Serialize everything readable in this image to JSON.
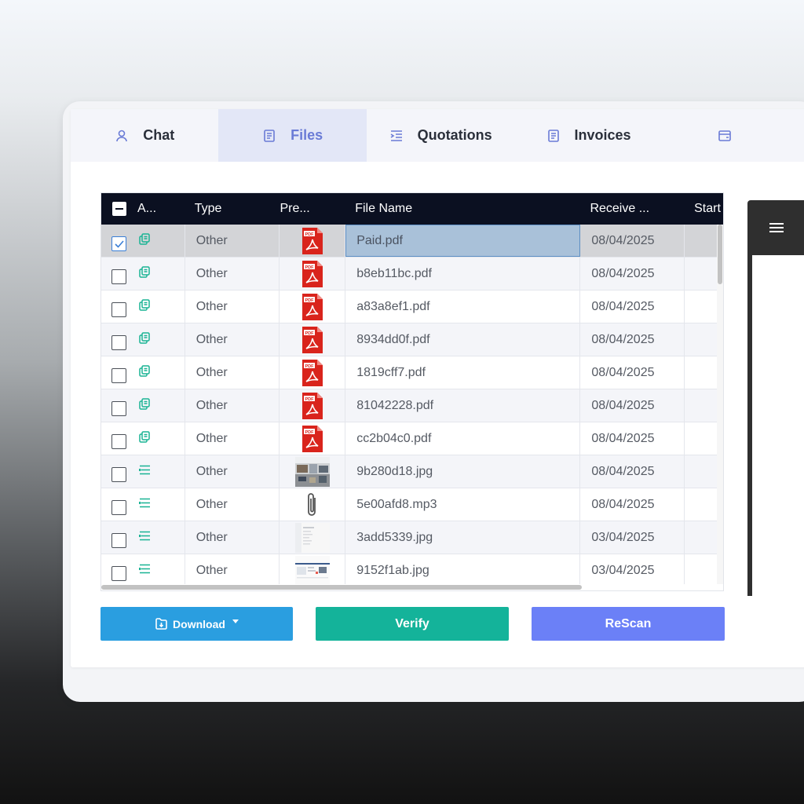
{
  "tabs": [
    {
      "label": "Chat",
      "icon": "user-icon",
      "active": false
    },
    {
      "label": "Files",
      "icon": "document-icon",
      "active": true
    },
    {
      "label": "Quotations",
      "icon": "list-indent-icon",
      "active": false
    },
    {
      "label": "Invoices",
      "icon": "document-icon",
      "active": false
    },
    {
      "label": "",
      "icon": "wallet-icon",
      "active": false
    }
  ],
  "table": {
    "columns": [
      "A...",
      "Type",
      "Pre...",
      "File Name",
      "Receive ...",
      "Start"
    ],
    "rows": [
      {
        "checked": true,
        "type_icon": "copy-icon",
        "type": "Other",
        "preview": "pdf-icon",
        "file": "Paid.pdf",
        "received": "08/04/2025"
      },
      {
        "checked": false,
        "type_icon": "copy-icon",
        "type": "Other",
        "preview": "pdf-icon",
        "file": "b8eb11bc.pdf",
        "received": "08/04/2025"
      },
      {
        "checked": false,
        "type_icon": "copy-icon",
        "type": "Other",
        "preview": "pdf-icon",
        "file": "a83a8ef1.pdf",
        "received": "08/04/2025"
      },
      {
        "checked": false,
        "type_icon": "copy-icon",
        "type": "Other",
        "preview": "pdf-icon",
        "file": "8934dd0f.pdf",
        "received": "08/04/2025"
      },
      {
        "checked": false,
        "type_icon": "copy-icon",
        "type": "Other",
        "preview": "pdf-icon",
        "file": "1819cff7.pdf",
        "received": "08/04/2025"
      },
      {
        "checked": false,
        "type_icon": "copy-icon",
        "type": "Other",
        "preview": "pdf-icon",
        "file": "81042228.pdf",
        "received": "08/04/2025"
      },
      {
        "checked": false,
        "type_icon": "copy-icon",
        "type": "Other",
        "preview": "pdf-icon",
        "file": "cc2b04c0.pdf",
        "received": "08/04/2025"
      },
      {
        "checked": false,
        "type_icon": "list-icon",
        "type": "Other",
        "preview": "photo-thumbnail",
        "file": "9b280d18.jpg",
        "received": "08/04/2025"
      },
      {
        "checked": false,
        "type_icon": "list-icon",
        "type": "Other",
        "preview": "paperclip-icon",
        "file": "5e00afd8.mp3",
        "received": "08/04/2025"
      },
      {
        "checked": false,
        "type_icon": "list-icon",
        "type": "Other",
        "preview": "document-thumbnail",
        "file": "3add5339.jpg",
        "received": "03/04/2025"
      },
      {
        "checked": false,
        "type_icon": "list-icon",
        "type": "Other",
        "preview": "screenshot-thumbnail",
        "file": "9152f1ab.jpg",
        "received": "03/04/2025"
      }
    ]
  },
  "buttons": {
    "download": "Download",
    "verify": "Verify",
    "rescan": "ReScan"
  },
  "viewer": {
    "menu_icon": "hamburger-menu-icon"
  },
  "colors": {
    "header_bg": "#0b1021",
    "active_tab": "#6a7bd6",
    "download": "#2a9ee0",
    "verify": "#14b39a",
    "rescan": "#6b80f7"
  }
}
